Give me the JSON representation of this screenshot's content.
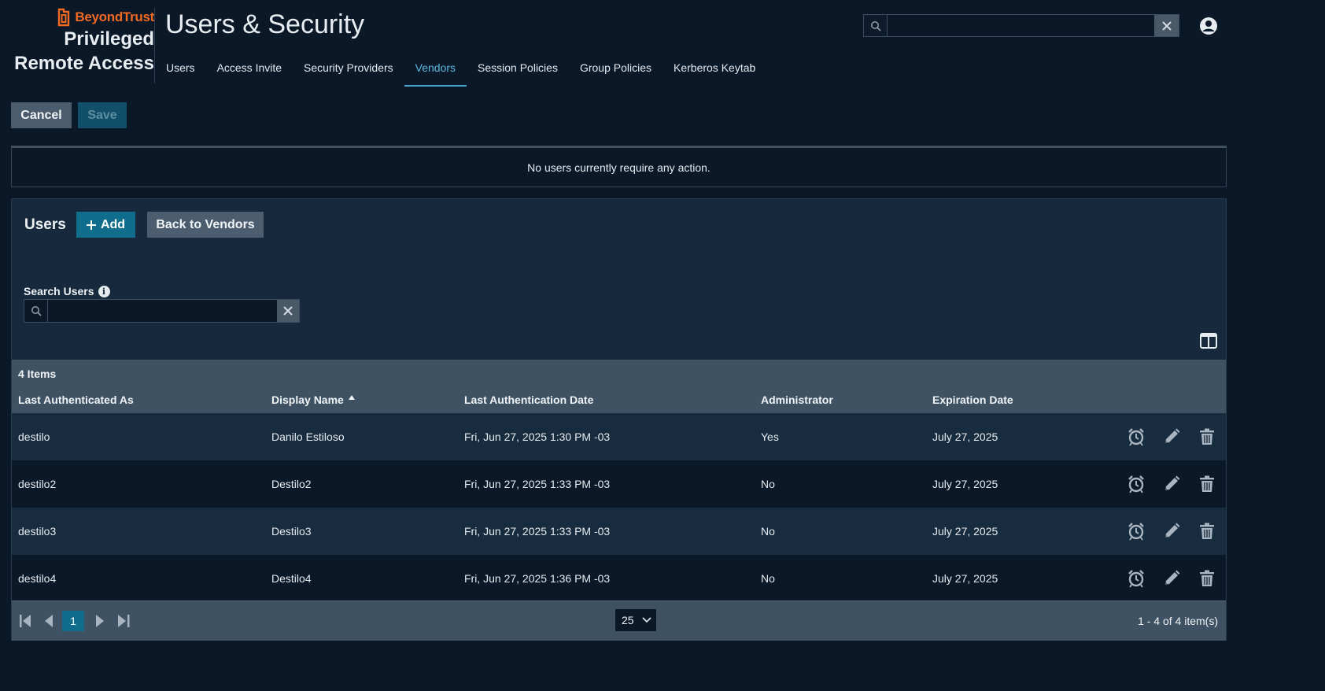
{
  "header": {
    "brand": "BeyondTrust",
    "product_line1": "Privileged",
    "product_line2": "Remote Access",
    "title": "Users & Security",
    "search_value": "",
    "tabs": [
      {
        "label": "Users"
      },
      {
        "label": "Access Invite"
      },
      {
        "label": "Security Providers"
      },
      {
        "label": "Vendors",
        "active": true
      },
      {
        "label": "Session Policies"
      },
      {
        "label": "Group Policies"
      },
      {
        "label": "Kerberos Keytab"
      }
    ]
  },
  "actions": {
    "cancel_label": "Cancel",
    "save_label": "Save"
  },
  "notice": "No users currently require any action.",
  "users_panel": {
    "title": "Users",
    "add_label": "Add",
    "back_label": "Back to Vendors",
    "search_label": "Search Users",
    "search_value": ""
  },
  "grid": {
    "count_label": "4 Items",
    "columns": [
      "Last Authenticated As",
      "Display Name",
      "Last Authentication Date",
      "Administrator",
      "Expiration Date"
    ],
    "sorted_column": "Display Name",
    "sort_direction": "ascending",
    "rows": [
      [
        "destilo",
        "Danilo Estiloso",
        "Fri, Jun 27, 2025 1:30 PM -03",
        "Yes",
        "July 27, 2025"
      ],
      [
        "destilo2",
        "Destilo2",
        "Fri, Jun 27, 2025 1:33 PM -03",
        "No",
        "July 27, 2025"
      ],
      [
        "destilo3",
        "Destilo3",
        "Fri, Jun 27, 2025 1:33 PM -03",
        "No",
        "July 27, 2025"
      ],
      [
        "destilo4",
        "Destilo4",
        "Fri, Jun 27, 2025 1:36 PM -03",
        "No",
        "July 27, 2025"
      ]
    ],
    "row_actions": [
      "alarm-clock-icon",
      "pencil-icon",
      "trash-icon"
    ]
  },
  "pager": {
    "page": "1",
    "page_size": "25",
    "range": "1 - 4 of 4 item(s)"
  },
  "colors": {
    "background": "#0b1828",
    "panel": "#172a3d",
    "accent": "#106d8c",
    "brand": "#f26a21",
    "active_tab": "#5bb8de"
  }
}
